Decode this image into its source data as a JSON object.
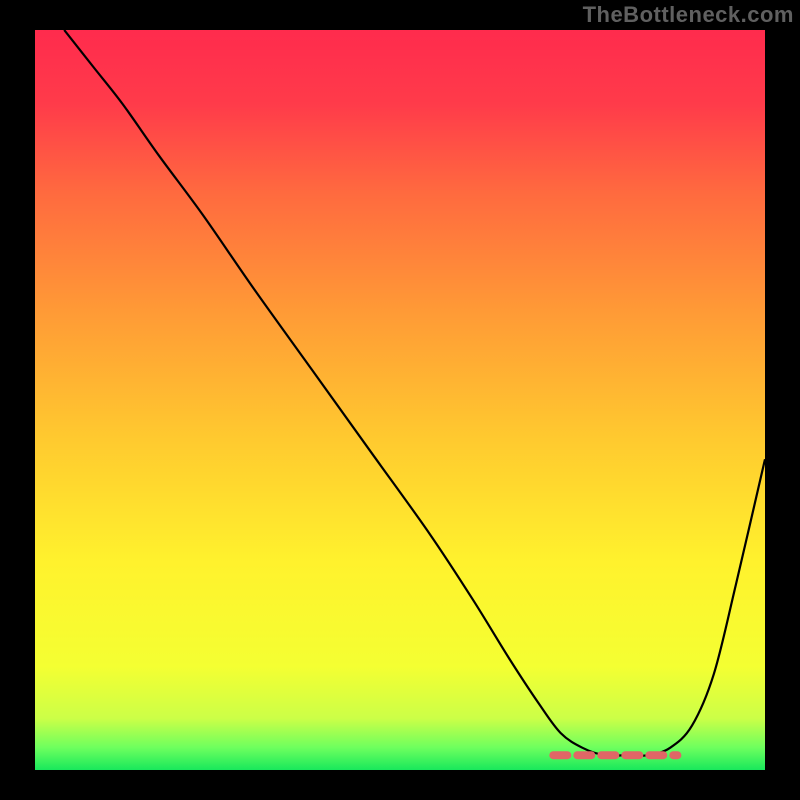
{
  "watermark": "TheBottleneck.com",
  "colors": {
    "highlight": "#e06666",
    "gradient_stops": [
      {
        "offset": 0.0,
        "color": "#ff2b4d"
      },
      {
        "offset": 0.1,
        "color": "#ff3b4a"
      },
      {
        "offset": 0.22,
        "color": "#ff6a3f"
      },
      {
        "offset": 0.38,
        "color": "#ff9a36"
      },
      {
        "offset": 0.55,
        "color": "#ffc92f"
      },
      {
        "offset": 0.72,
        "color": "#fff22d"
      },
      {
        "offset": 0.86,
        "color": "#f4ff32"
      },
      {
        "offset": 0.93,
        "color": "#ccff47"
      },
      {
        "offset": 0.97,
        "color": "#6dff5e"
      },
      {
        "offset": 1.0,
        "color": "#18e85c"
      }
    ]
  },
  "chart_data": {
    "type": "line",
    "title": "",
    "xlabel": "",
    "ylabel": "",
    "xlim": [
      0,
      100
    ],
    "ylim": [
      0,
      100
    ],
    "series": [
      {
        "name": "bottleneck_curve",
        "x": [
          4,
          8,
          12,
          17,
          23,
          30,
          38,
          46,
          54,
          60,
          65,
          69,
          72,
          75,
          78,
          81,
          84,
          87,
          90,
          93,
          96,
          100
        ],
        "y": [
          100,
          95,
          90,
          83,
          75,
          65,
          54,
          43,
          32,
          23,
          15,
          9,
          5,
          3,
          2,
          2,
          2,
          3,
          6,
          13,
          25,
          42
        ]
      }
    ],
    "flat_region": {
      "x_start": 71,
      "x_end": 88,
      "y": 2
    }
  }
}
